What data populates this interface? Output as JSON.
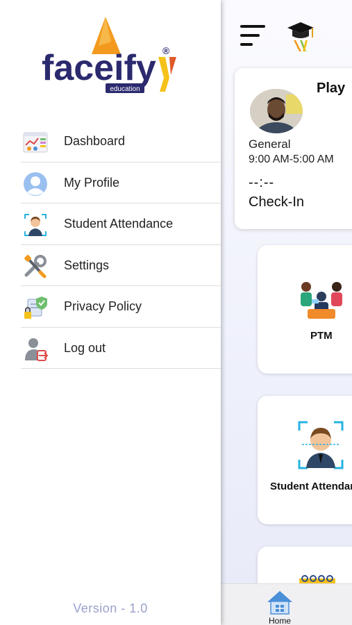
{
  "drawer": {
    "logo": {
      "word": "faceify",
      "sub": "education",
      "mark": "®"
    },
    "menu": [
      {
        "label": "Dashboard",
        "icon": "dashboard-icon"
      },
      {
        "label": "My Profile",
        "icon": "profile-icon"
      },
      {
        "label": "Student Attendance",
        "icon": "student-attendance-icon"
      },
      {
        "label": "Settings",
        "icon": "settings-icon"
      },
      {
        "label": "Privacy Policy",
        "icon": "privacy-policy-icon"
      },
      {
        "label": "Log out",
        "icon": "logout-icon"
      }
    ],
    "version": "Version - 1.0"
  },
  "main": {
    "card": {
      "title": "Play",
      "shift_name": "General",
      "shift_time": "9:00 AM-5:00 AM",
      "clock": "--:--",
      "status": "Check-In"
    },
    "tiles": [
      {
        "label": "PTM",
        "icon": "ptm-icon"
      },
      {
        "label": "Student Attendance",
        "icon": "student-attendance-icon"
      }
    ],
    "bottom_nav": {
      "home_label": "Home"
    }
  },
  "colors": {
    "brand_navy": "#2b2a6e",
    "brand_orange": "#f39a1e",
    "brand_yellow": "#f4c21a",
    "version_text": "#9aa0cc"
  }
}
